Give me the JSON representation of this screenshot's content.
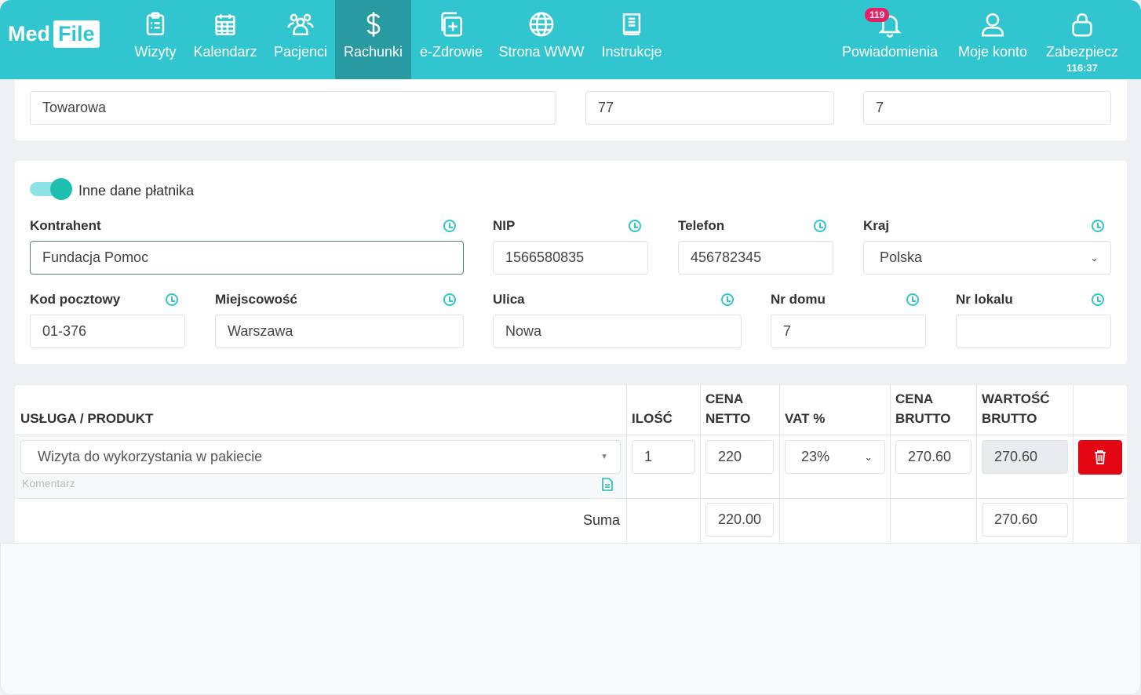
{
  "header": {
    "logo": {
      "part1": "Med",
      "part2": "File"
    },
    "nav": [
      {
        "label": "Wizyty",
        "icon": "clipboard-icon"
      },
      {
        "label": "Kalendarz",
        "icon": "calendar-icon"
      },
      {
        "label": "Pacjenci",
        "icon": "users-icon"
      },
      {
        "label": "Rachunki",
        "icon": "dollar-icon",
        "active": true
      },
      {
        "label": "e-Zdrowie",
        "icon": "medical-file-icon"
      },
      {
        "label": "Strona WWW",
        "icon": "globe-icon"
      },
      {
        "label": "Instrukcje",
        "icon": "book-icon"
      }
    ],
    "right": [
      {
        "label": "Powiadomienia",
        "icon": "bell-icon",
        "badge": "119"
      },
      {
        "label": "Moje konto",
        "icon": "user-icon"
      },
      {
        "label": "Zabezpiecz",
        "icon": "lock-icon",
        "sub": "116:37"
      }
    ]
  },
  "address": {
    "ulica": "Towarowa",
    "nr_domu": "77",
    "nr_lokalu": "7"
  },
  "payer": {
    "toggle_label": "Inne dane płatnika",
    "toggle_on": true,
    "fields": {
      "kontrahent": {
        "label": "Kontrahent",
        "value": "Fundacja Pomoc"
      },
      "nip": {
        "label": "NIP",
        "value": "1566580835"
      },
      "telefon": {
        "label": "Telefon",
        "value": "456782345"
      },
      "kraj": {
        "label": "Kraj",
        "value": "Polska"
      },
      "kod": {
        "label": "Kod pocztowy",
        "value": "01-376"
      },
      "miejscowosc": {
        "label": "Miejscowość",
        "value": "Warszawa"
      },
      "ulica": {
        "label": "Ulica",
        "value": "Nowa"
      },
      "nr_domu": {
        "label": "Nr domu",
        "value": "7"
      },
      "nr_lokalu": {
        "label": "Nr lokalu",
        "value": ""
      }
    }
  },
  "table": {
    "headers": {
      "product": "USŁUGA / PRODUKT",
      "qty": "ILOŚĆ",
      "net1": "CENA",
      "net2": "NETTO",
      "vat": "VAT %",
      "gross1": "CENA",
      "gross2": "BRUTTO",
      "val1": "WARTOŚĆ",
      "val2": "BRUTTO"
    },
    "row": {
      "product": "Wizyta do wykorzystania w pakiecie",
      "comment_placeholder": "Komentarz",
      "qty": "1",
      "net": "220",
      "vat": "23%",
      "gross": "270.60",
      "value": "270.60"
    },
    "sum": {
      "label": "Suma",
      "net": "220.00",
      "value": "270.60"
    }
  },
  "colors": {
    "accent": "#30c5cf",
    "active": "#279ba1",
    "delete": "#e30613",
    "badge": "#e91e63"
  }
}
